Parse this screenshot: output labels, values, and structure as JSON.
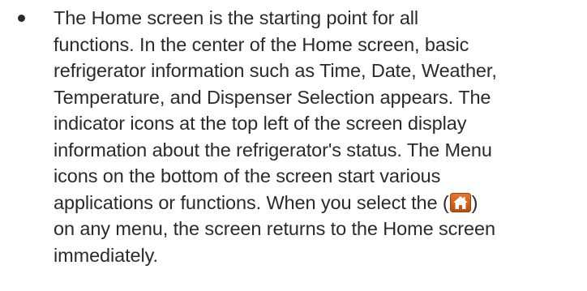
{
  "bullet": {
    "lines": [
      "The Home screen is the starting point for all",
      "functions. In the center of the Home screen, basic",
      "refrigerator information such as Time, Date, Weather,",
      "Temperature, and Dispenser Selection appears. The",
      "indicator icons at the top left of the screen display",
      "information about the refrigerator's status. The Menu",
      "icons on the bottom of the screen start various",
      "applications or functions. When you select the (",
      ")",
      "on any menu, the screen returns to the Home screen",
      "immediately."
    ],
    "inline_icon": "home-icon",
    "inline_icon_color": "#d9621f"
  }
}
